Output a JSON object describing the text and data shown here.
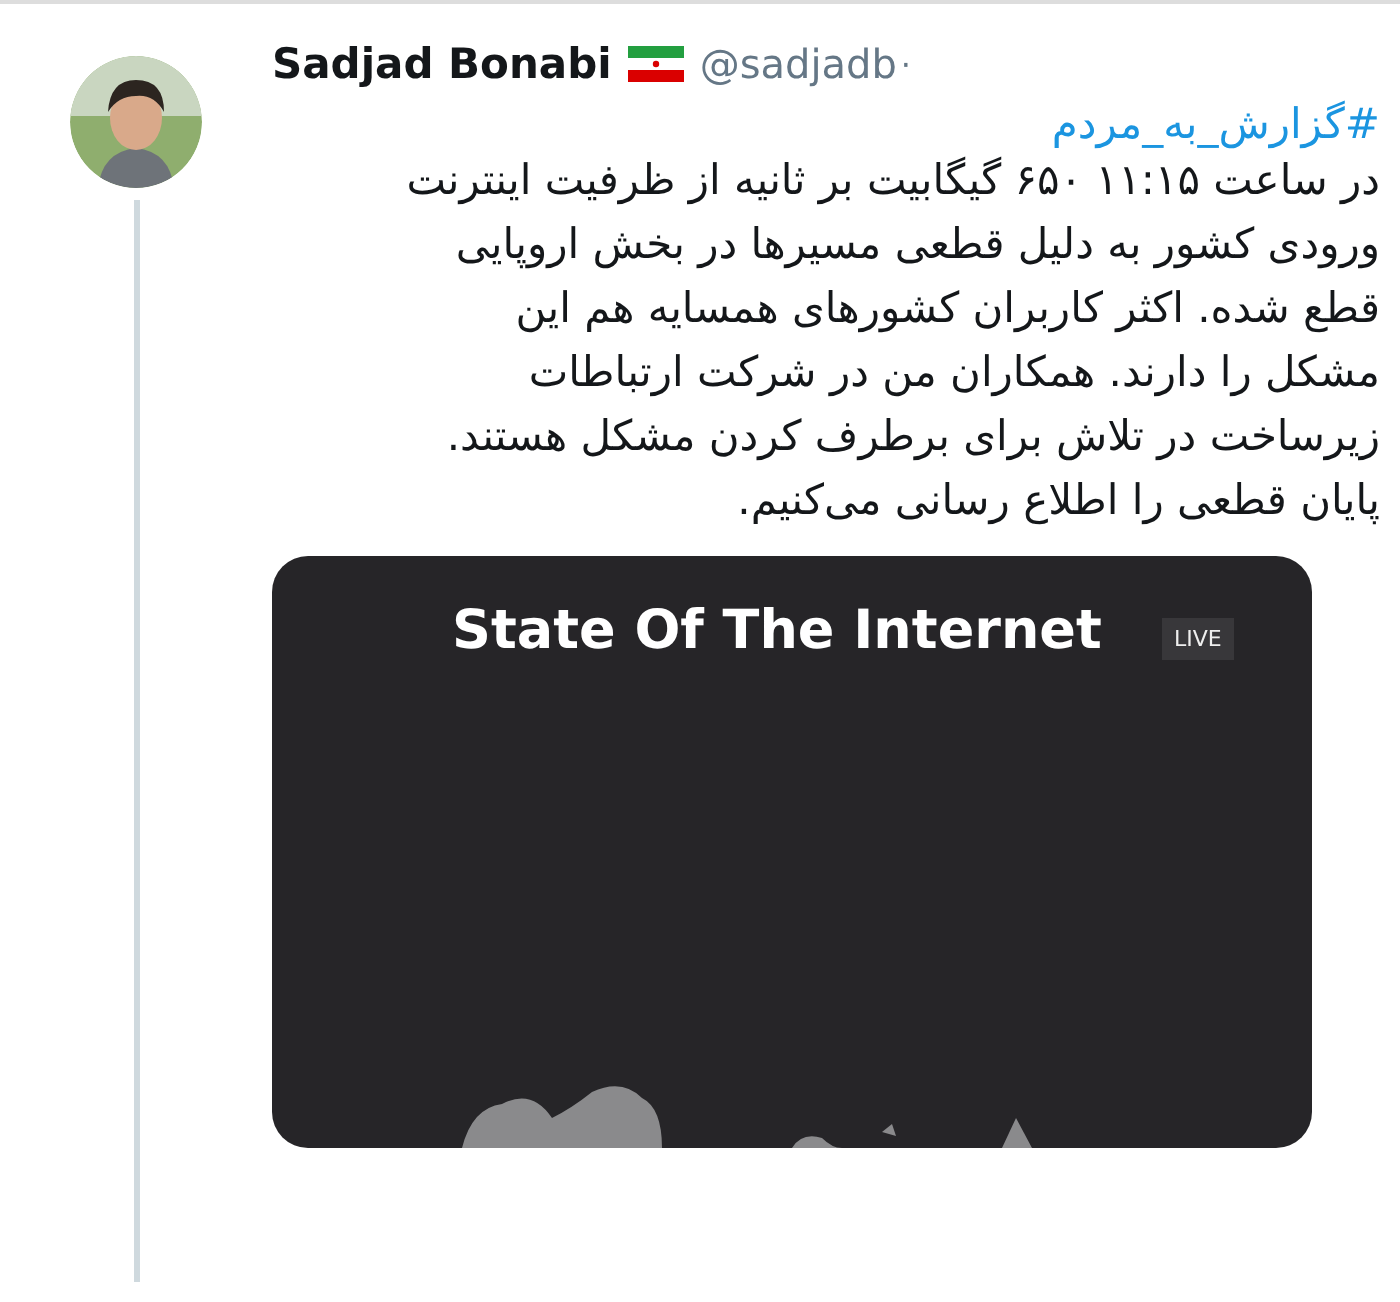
{
  "tweet": {
    "author": {
      "name": "Sadjad Bonabi",
      "handle": "@sadjadb",
      "separator": "·"
    },
    "hashtag": "#گزارش_به_مردم",
    "text": "در ساعت ۱۱:۱۵ ۶۵۰ گیگابیت بر ثانیه از ظرفیت اینترنت ورودی کشور به دلیل قطعی مسیرها در بخش اروپایی قطع شده. اکثر کاربران کشورهای همسایه هم این مشکل را دارند. همکاران من در شرکت ارتباطات زیرساخت در تلاش برای برطرف کردن مشکل هستند. پایان قطعی را اطلاع رسانی می‌کنیم.",
    "media": {
      "title": "State Of The Internet",
      "badge": "LIVE"
    }
  }
}
